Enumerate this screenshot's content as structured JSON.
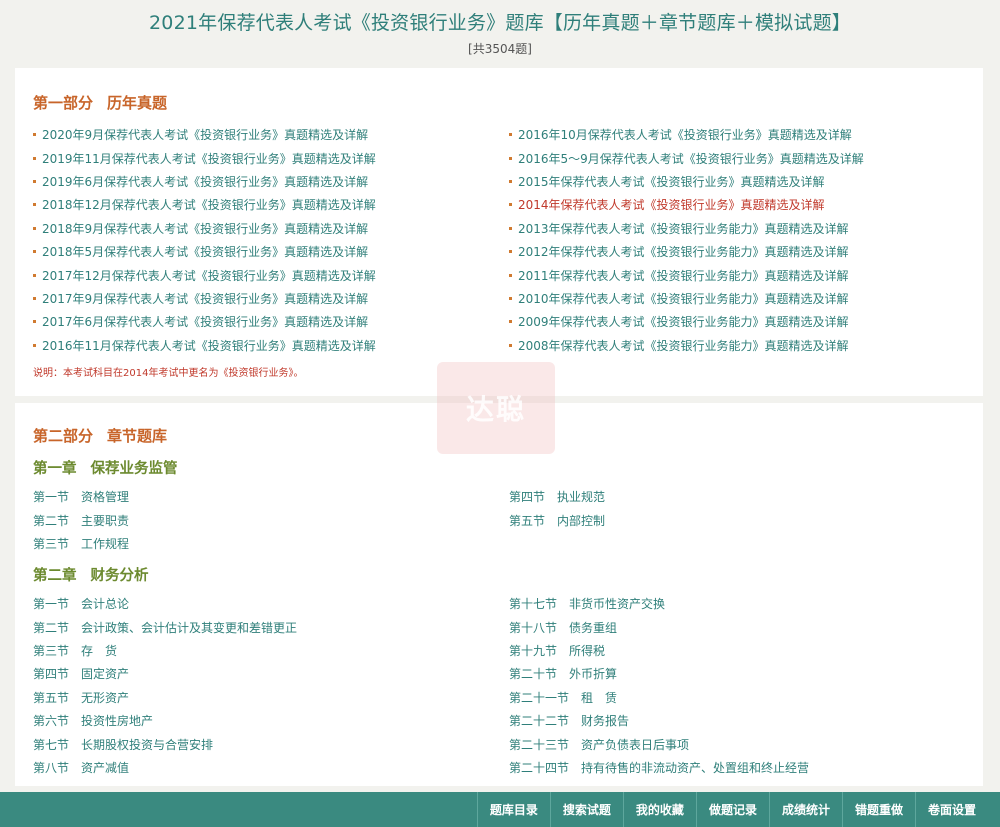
{
  "header": {
    "title": "2021年保荐代表人考试《投资银行业务》题库【历年真题＋章节题库＋模拟试题】",
    "count": "[共3504题]"
  },
  "part1": {
    "label": "第一部分",
    "name": "历年真题",
    "left": [
      "2020年9月保荐代表人考试《投资银行业务》真题精选及详解",
      "2019年11月保荐代表人考试《投资银行业务》真题精选及详解",
      "2019年6月保荐代表人考试《投资银行业务》真题精选及详解",
      "2018年12月保荐代表人考试《投资银行业务》真题精选及详解",
      "2018年9月保荐代表人考试《投资银行业务》真题精选及详解",
      "2018年5月保荐代表人考试《投资银行业务》真题精选及详解",
      "2017年12月保荐代表人考试《投资银行业务》真题精选及详解",
      "2017年9月保荐代表人考试《投资银行业务》真题精选及详解",
      "2017年6月保荐代表人考试《投资银行业务》真题精选及详解",
      "2016年11月保荐代表人考试《投资银行业务》真题精选及详解"
    ],
    "right": [
      "2016年10月保荐代表人考试《投资银行业务》真题精选及详解",
      "2016年5～9月保荐代表人考试《投资银行业务》真题精选及详解",
      "2015年保荐代表人考试《投资银行业务》真题精选及详解",
      "2014年保荐代表人考试《投资银行业务》真题精选及详解",
      "2013年保荐代表人考试《投资银行业务能力》真题精选及详解",
      "2012年保荐代表人考试《投资银行业务能力》真题精选及详解",
      "2011年保荐代表人考试《投资银行业务能力》真题精选及详解",
      "2010年保荐代表人考试《投资银行业务能力》真题精选及详解",
      "2009年保荐代表人考试《投资银行业务能力》真题精选及详解",
      "2008年保荐代表人考试《投资银行业务能力》真题精选及详解"
    ],
    "note": "说明：本考试科目在2014年考试中更名为《投资银行业务》。"
  },
  "part2": {
    "label": "第二部分",
    "name": "章节题库",
    "chapter1": {
      "label": "第一章",
      "name": "保荐业务监管",
      "left": [
        {
          "num": "第一节",
          "name": "资格管理"
        },
        {
          "num": "第二节",
          "name": "主要职责"
        },
        {
          "num": "第三节",
          "name": "工作规程"
        }
      ],
      "right": [
        {
          "num": "第四节",
          "name": "执业规范"
        },
        {
          "num": "第五节",
          "name": "内部控制"
        }
      ]
    },
    "chapter2": {
      "label": "第二章",
      "name": "财务分析",
      "left": [
        {
          "num": "第一节",
          "name": "会计总论"
        },
        {
          "num": "第二节",
          "name": "会计政策、会计估计及其变更和差错更正"
        },
        {
          "num": "第三节",
          "name": "存　货"
        },
        {
          "num": "第四节",
          "name": "固定资产"
        },
        {
          "num": "第五节",
          "name": "无形资产"
        },
        {
          "num": "第六节",
          "name": "投资性房地产"
        },
        {
          "num": "第七节",
          "name": "长期股权投资与合营安排"
        },
        {
          "num": "第八节",
          "name": "资产减值"
        }
      ],
      "right": [
        {
          "num": "第十七节",
          "name": "非货币性资产交换"
        },
        {
          "num": "第十八节",
          "name": "债务重组"
        },
        {
          "num": "第十九节",
          "name": "所得税"
        },
        {
          "num": "第二十节",
          "name": "外币折算"
        },
        {
          "num": "第二十一节",
          "name": "租　赁"
        },
        {
          "num": "第二十二节",
          "name": "财务报告"
        },
        {
          "num": "第二十三节",
          "name": "资产负债表日后事项"
        },
        {
          "num": "第二十四节",
          "name": "持有待售的非流动资产、处置组和终止经营"
        }
      ]
    }
  },
  "watermark": "达聪",
  "bottom_nav": [
    "题库目录",
    "搜索试题",
    "我的收藏",
    "做题记录",
    "成绩统计",
    "错题重做",
    "卷面设置"
  ],
  "colors": {
    "accent": "#2f7f7a",
    "highlight": "#c0392b",
    "part_title": "#c8652a",
    "chapter": "#6c8a2f",
    "bar": "#3a8a80"
  }
}
